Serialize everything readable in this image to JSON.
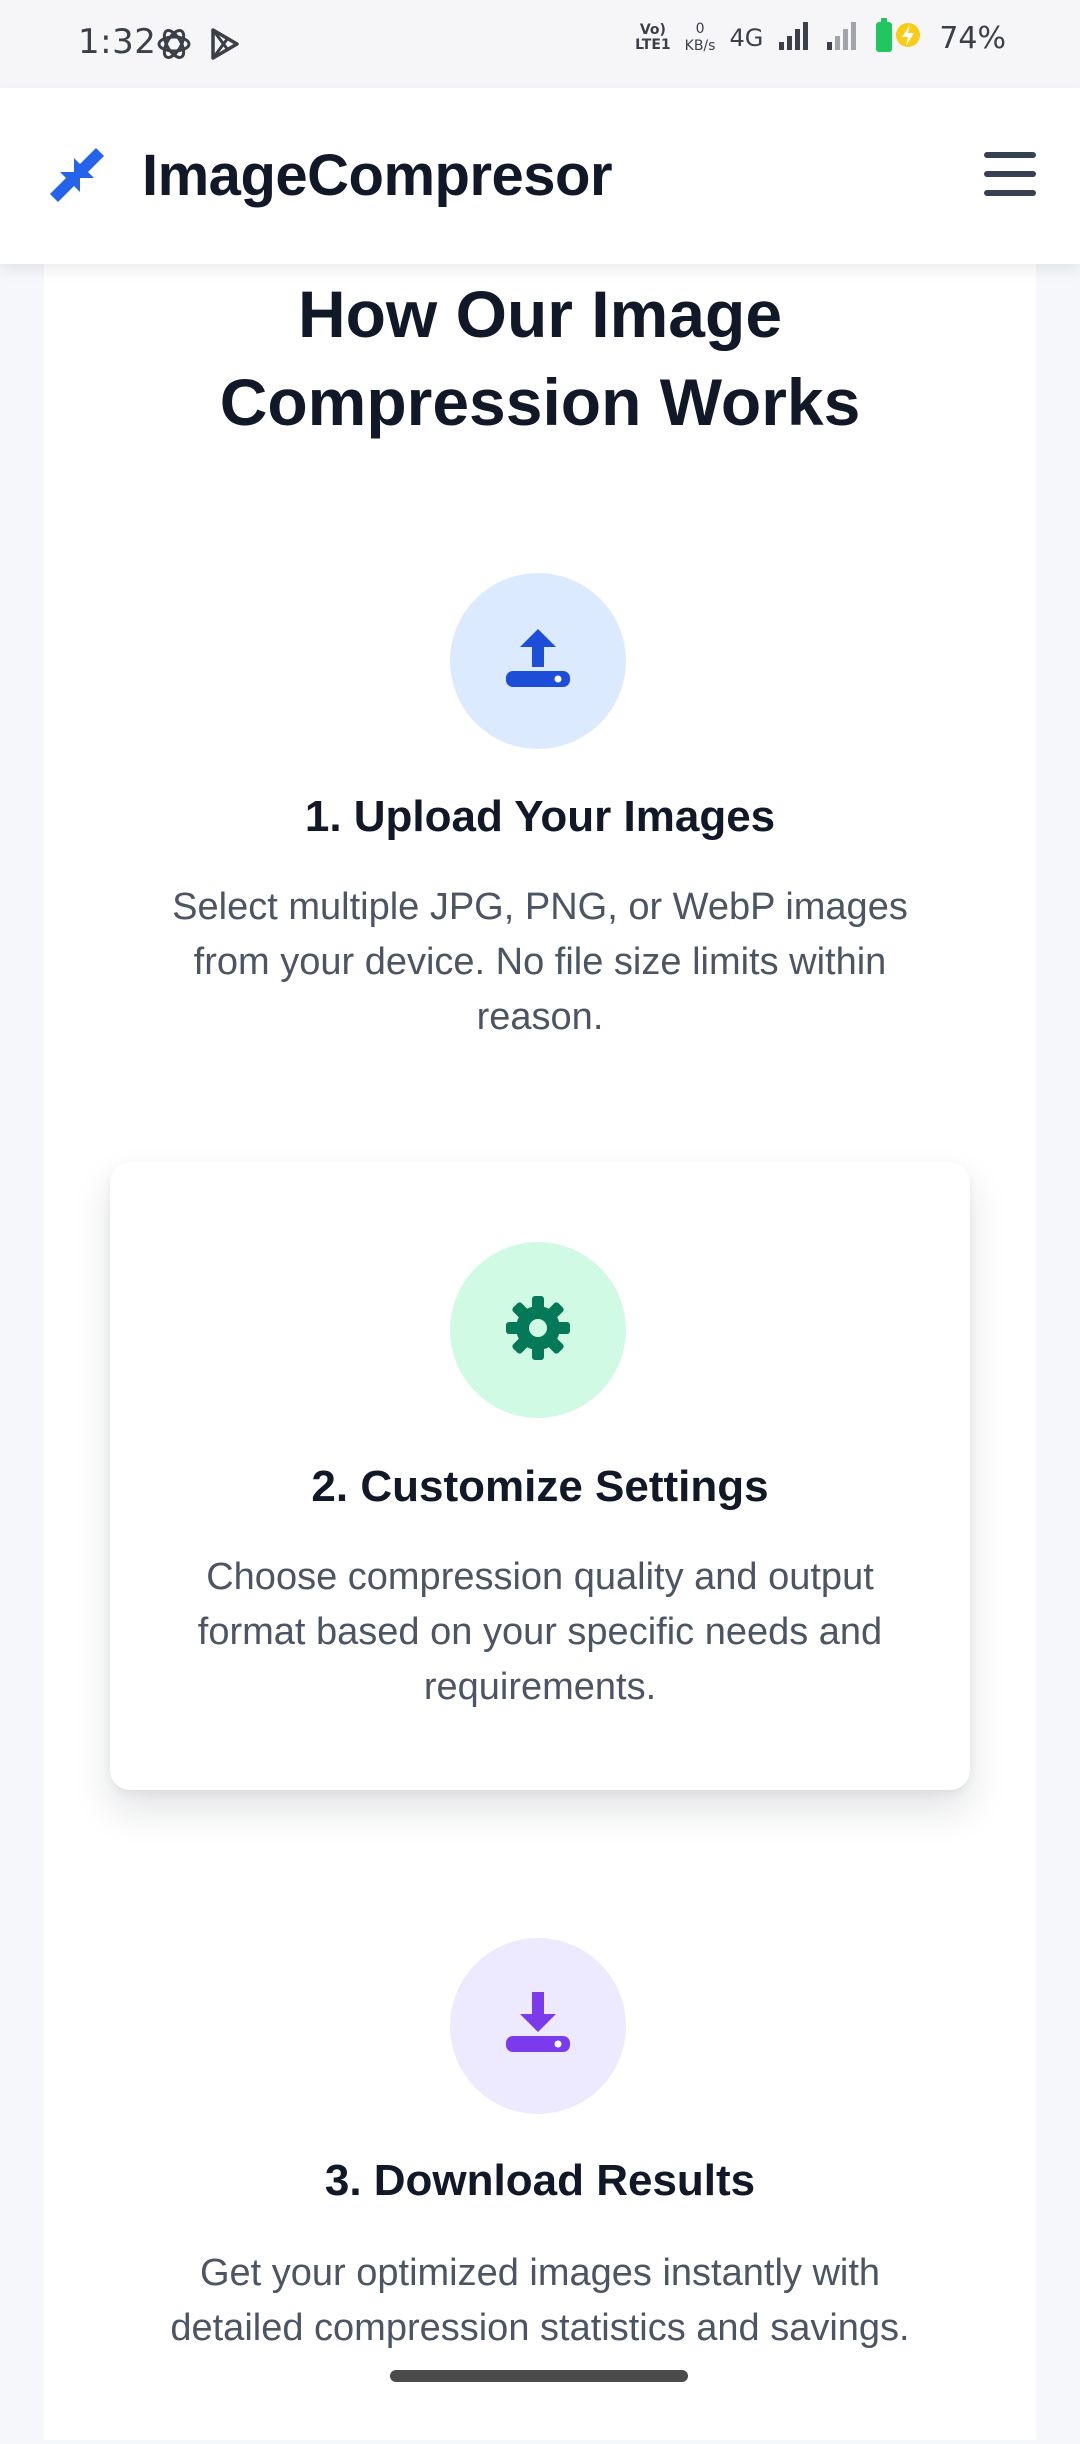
{
  "status_bar": {
    "time": "1:32",
    "volte_top": "Vo)",
    "volte_bottom": "LTE1",
    "net_speed_value": "0",
    "net_speed_unit": "KB/s",
    "network_type": "4G",
    "battery_percent": "74%"
  },
  "header": {
    "app_name": "ImageCompresor",
    "logo_icon": "compress-arrows-icon",
    "menu_icon": "hamburger-icon"
  },
  "section": {
    "title_line1": "How Our Image",
    "title_line2": "Compression Works"
  },
  "steps": [
    {
      "title": "1. Upload Your Images",
      "description": "Select multiple JPG, PNG, or WebP images from your device. No file size limits within reason.",
      "icon": "upload-icon",
      "icon_color": "#1d4ed8",
      "icon_bg": "#dbeafe"
    },
    {
      "title": "2. Customize Settings",
      "description": "Choose compression quality and output format based on your specific needs and requirements.",
      "icon": "gear-icon",
      "icon_color": "#047857",
      "icon_bg": "#d1fae5"
    },
    {
      "title": "3. Download Results",
      "description": "Get your optimized images instantly with detailed compression statistics and savings.",
      "icon": "download-icon",
      "icon_color": "#7c3aed",
      "icon_bg": "#ede9fe"
    }
  ],
  "colors": {
    "brand_blue": "#2563eb",
    "text_dark": "#111827",
    "text_muted": "#4b5563"
  }
}
